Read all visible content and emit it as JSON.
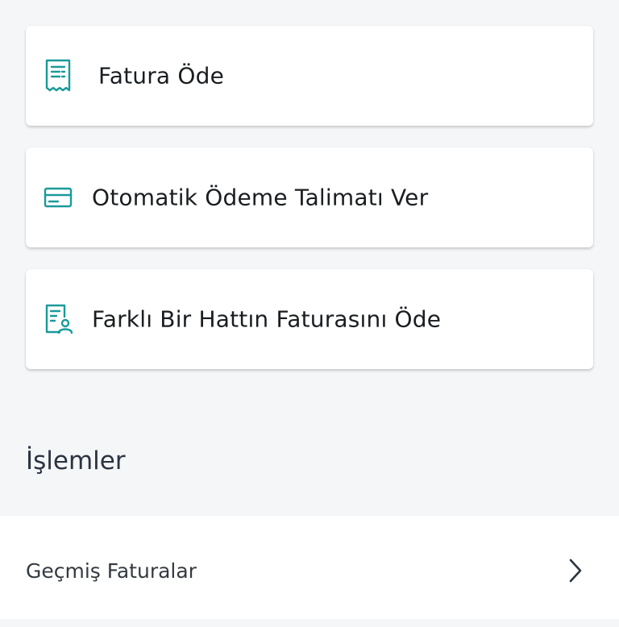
{
  "cards": [
    {
      "label": "Fatura Öde",
      "icon": "receipt-icon"
    },
    {
      "label": "Otomatik Ödeme Talimatı Ver",
      "icon": "credit-card-icon"
    },
    {
      "label": "Farklı Bir Hattın Faturasını Öde",
      "icon": "document-user-icon"
    }
  ],
  "section": {
    "title": "İşlemler"
  },
  "list": {
    "items": [
      {
        "label": "Geçmiş Faturalar",
        "icon": "chevron-right-icon"
      }
    ]
  },
  "colors": {
    "accent": "#1a9a9a",
    "background": "#f5f6f8",
    "card": "#ffffff",
    "text": "#1a1d21"
  }
}
